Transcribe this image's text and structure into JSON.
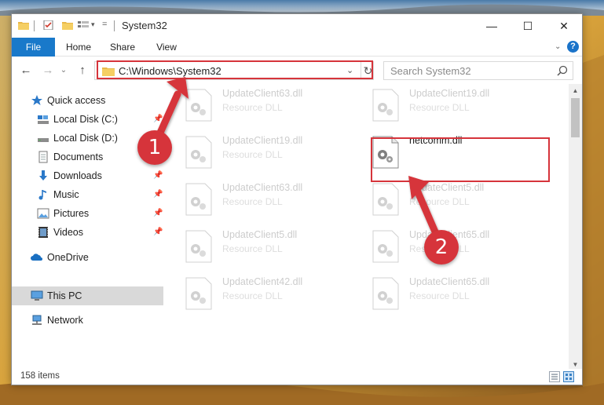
{
  "window": {
    "title": "System32",
    "minimize_glyph": "—",
    "maximize_glyph": "☐",
    "close_glyph": "✕"
  },
  "ribbon": {
    "tabs": [
      "File",
      "Home",
      "Share",
      "View"
    ],
    "chevron": "⌄",
    "help": "?"
  },
  "address": {
    "path": "C:\\Windows\\System32",
    "dropdown_glyph": "⌄",
    "refresh_glyph": "↻"
  },
  "search": {
    "placeholder": "Search System32"
  },
  "nav": {
    "back": "←",
    "forward": "→",
    "recent": "⌄",
    "up": "↑"
  },
  "sidebar": {
    "items": [
      {
        "label": "Quick access",
        "icon": "star-icon",
        "pinned": false
      },
      {
        "label": "Local Disk (C:)",
        "icon": "drive-icon",
        "pinned": true
      },
      {
        "label": "Local Disk (D:)",
        "icon": "drive-icon",
        "pinned": false
      },
      {
        "label": "Documents",
        "icon": "documents-icon",
        "pinned": true
      },
      {
        "label": "Downloads",
        "icon": "download-icon",
        "pinned": true
      },
      {
        "label": "Music",
        "icon": "music-icon",
        "pinned": true
      },
      {
        "label": "Pictures",
        "icon": "pictures-icon",
        "pinned": true
      },
      {
        "label": "Videos",
        "icon": "videos-icon",
        "pinned": true
      },
      {
        "label": "OneDrive",
        "icon": "cloud-icon",
        "pinned": false
      },
      {
        "label": "This PC",
        "icon": "pc-icon",
        "pinned": false,
        "selected": true
      },
      {
        "label": "Network",
        "icon": "network-icon",
        "pinned": false
      }
    ],
    "pin_glyph": "📌"
  },
  "files": [
    {
      "name": "UpdateClient63.dll",
      "desc": "Resource DLL"
    },
    {
      "name": "UpdateClient19.dll",
      "desc": "Resource DLL"
    },
    {
      "name": "UpdateClient19.dll",
      "desc": "Resource DLL"
    },
    {
      "name": "netcomm.dll",
      "desc": ""
    },
    {
      "name": "UpdateClient63.dll",
      "desc": "Resource DLL"
    },
    {
      "name": "UpdateClient5.dll",
      "desc": "Resource DLL"
    },
    {
      "name": "UpdateClient5.dll",
      "desc": "Resource DLL"
    },
    {
      "name": "UpdateClient65.dll",
      "desc": "Resource DLL"
    },
    {
      "name": "UpdateClient42.dll",
      "desc": "Resource DLL"
    },
    {
      "name": "UpdateClient65.dll",
      "desc": "Resource DLL"
    }
  ],
  "status": {
    "count": "158 items"
  },
  "annotations": [
    "1",
    "2"
  ],
  "colors": {
    "accent": "#1979ca",
    "highlight": "#d6343b"
  }
}
